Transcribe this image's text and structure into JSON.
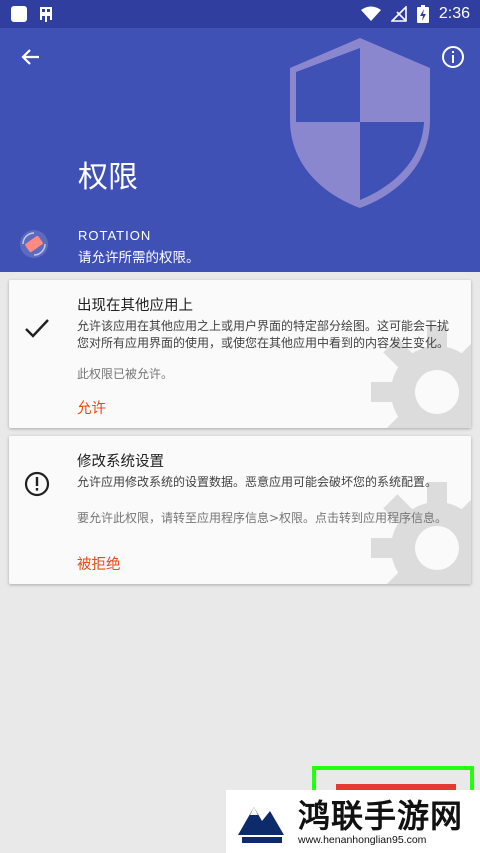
{
  "status_bar": {
    "time": "2:36"
  },
  "header": {
    "title": "权限",
    "app_name": "ROTATION",
    "subtitle": "请允许所需的权限。"
  },
  "cards": [
    {
      "title": "出现在其他应用上",
      "description": "允许该应用在其他应用之上或用户界面的特定部分绘图。这可能会干扰您对所有应用界面的使用，或使您在其他应用中看到的内容发生变化。",
      "note": "此权限已被允许。",
      "action": "允许",
      "state_icon": "check-icon"
    },
    {
      "title": "修改系统设置",
      "description": "允许应用修改系统的设置数据。恶意应用可能会破坏您的系统配置。",
      "note": "要允许此权限，请转至应用程序信息>权限。点击转到应用程序信息。",
      "action": "被拒绝",
      "state_icon": "alert-circle-icon"
    }
  ],
  "watermark": {
    "title": "鸿联手游网",
    "url": "www.henanhonglian95.com"
  },
  "colors": {
    "primary": "#3f51b5",
    "primary_dark": "#303f9f",
    "accent": "#e64a19",
    "highlight": "#22ff11"
  }
}
